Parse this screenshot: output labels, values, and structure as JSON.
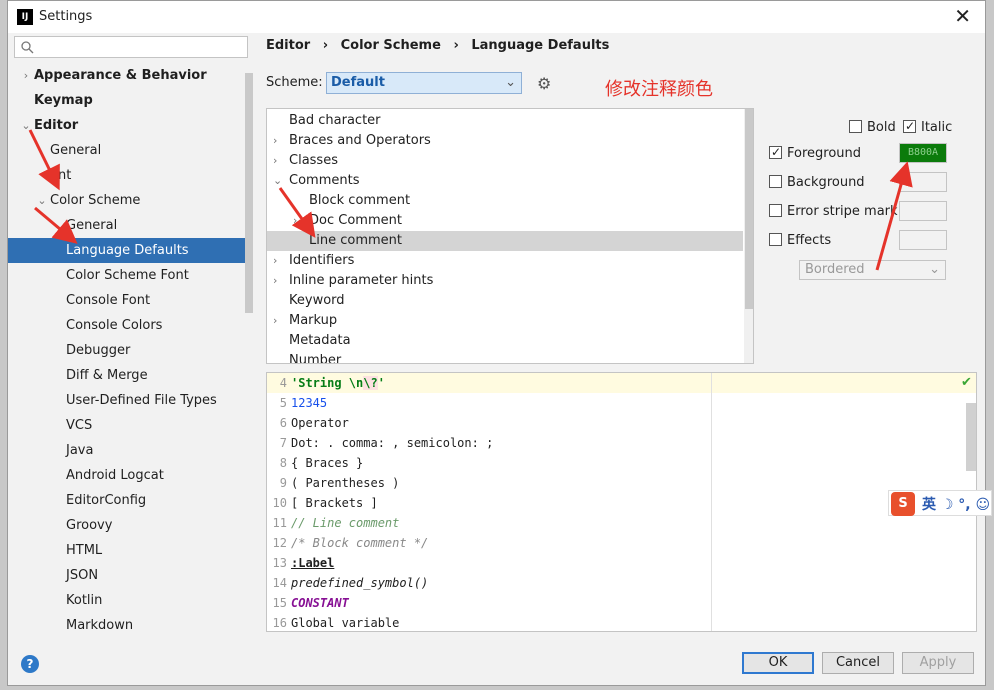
{
  "window": {
    "title": "Settings"
  },
  "search": {
    "placeholder": ""
  },
  "sidebar": {
    "items": [
      {
        "label": "Appearance & Behavior",
        "bold": true,
        "arrow": "›",
        "indent": 0
      },
      {
        "label": "Keymap",
        "bold": true,
        "arrow": "",
        "indent": 0
      },
      {
        "label": "Editor",
        "bold": true,
        "arrow": "⌄",
        "indent": 0
      },
      {
        "label": "General",
        "bold": false,
        "arrow": "",
        "indent": 1
      },
      {
        "label": "ont",
        "bold": false,
        "arrow": "",
        "indent": 1
      },
      {
        "label": "Color Scheme",
        "bold": false,
        "arrow": "⌄",
        "indent": 1
      },
      {
        "label": "General",
        "bold": false,
        "arrow": "",
        "indent": 2
      },
      {
        "label": "Language Defaults",
        "bold": false,
        "arrow": "",
        "indent": 2,
        "selected": true
      },
      {
        "label": "Color Scheme Font",
        "bold": false,
        "arrow": "",
        "indent": 2
      },
      {
        "label": "Console Font",
        "bold": false,
        "arrow": "",
        "indent": 2
      },
      {
        "label": "Console Colors",
        "bold": false,
        "arrow": "",
        "indent": 2
      },
      {
        "label": "Debugger",
        "bold": false,
        "arrow": "",
        "indent": 2
      },
      {
        "label": "Diff & Merge",
        "bold": false,
        "arrow": "",
        "indent": 2
      },
      {
        "label": "User-Defined File Types",
        "bold": false,
        "arrow": "",
        "indent": 2
      },
      {
        "label": "VCS",
        "bold": false,
        "arrow": "",
        "indent": 2
      },
      {
        "label": "Java",
        "bold": false,
        "arrow": "",
        "indent": 2
      },
      {
        "label": "Android Logcat",
        "bold": false,
        "arrow": "",
        "indent": 2
      },
      {
        "label": "EditorConfig",
        "bold": false,
        "arrow": "",
        "indent": 2
      },
      {
        "label": "Groovy",
        "bold": false,
        "arrow": "",
        "indent": 2
      },
      {
        "label": "HTML",
        "bold": false,
        "arrow": "",
        "indent": 2
      },
      {
        "label": "JSON",
        "bold": false,
        "arrow": "",
        "indent": 2
      },
      {
        "label": "Kotlin",
        "bold": false,
        "arrow": "",
        "indent": 2
      },
      {
        "label": "Markdown",
        "bold": false,
        "arrow": "",
        "indent": 2
      }
    ]
  },
  "breadcrumb": {
    "editor": "Editor",
    "color_scheme": "Color Scheme",
    "language_defaults": "Language Defaults",
    "separator": "›"
  },
  "scheme": {
    "label": "Scheme:",
    "value": "Default"
  },
  "annotation": "修改注释颜色",
  "attributes": [
    {
      "label": "Bad character",
      "arrow": "",
      "indent": 0
    },
    {
      "label": "Braces and Operators",
      "arrow": "›",
      "indent": 0
    },
    {
      "label": "Classes",
      "arrow": "›",
      "indent": 0
    },
    {
      "label": "Comments",
      "arrow": "⌄",
      "indent": 0
    },
    {
      "label": "Block comment",
      "arrow": "",
      "indent": 1
    },
    {
      "label": "Doc Comment",
      "arrow": "›",
      "indent": 1
    },
    {
      "label": "Line comment",
      "arrow": "",
      "indent": 1,
      "selected": true
    },
    {
      "label": "Identifiers",
      "arrow": "›",
      "indent": 0
    },
    {
      "label": "Inline parameter hints",
      "arrow": "›",
      "indent": 0
    },
    {
      "label": "Keyword",
      "arrow": "",
      "indent": 0
    },
    {
      "label": "Markup",
      "arrow": "›",
      "indent": 0
    },
    {
      "label": "Metadata",
      "arrow": "",
      "indent": 0
    },
    {
      "label": "Number",
      "arrow": "",
      "indent": 0
    }
  ],
  "options": {
    "bold": {
      "label": "Bold",
      "checked": false
    },
    "italic": {
      "label": "Italic",
      "checked": true
    },
    "foreground": {
      "label": "Foreground",
      "checked": true,
      "color": "B800A"
    },
    "background": {
      "label": "Background",
      "checked": false
    },
    "error_stripe": {
      "label": "Error stripe mark",
      "checked": false
    },
    "effects": {
      "label": "Effects",
      "checked": false,
      "style": "Bordered"
    }
  },
  "editor": {
    "lines": [
      {
        "n": "4",
        "parts": [
          {
            "t": "'String \\",
            "c": "c-str"
          },
          {
            "t": "n",
            "c": "c-str"
          },
          {
            "t": "\\?",
            "c": "c-str esc"
          },
          {
            "t": "'",
            "c": "c-str"
          }
        ]
      },
      {
        "n": "5",
        "parts": [
          {
            "t": "12345",
            "c": "c-num"
          }
        ]
      },
      {
        "n": "6",
        "parts": [
          {
            "t": "Operator",
            "c": ""
          }
        ]
      },
      {
        "n": "7",
        "parts": [
          {
            "t": "Dot: . comma: , semicolon: ;",
            "c": ""
          }
        ]
      },
      {
        "n": "8",
        "parts": [
          {
            "t": "{ Braces }",
            "c": ""
          }
        ]
      },
      {
        "n": "9",
        "parts": [
          {
            "t": "( Parentheses )",
            "c": ""
          }
        ]
      },
      {
        "n": "10",
        "parts": [
          {
            "t": "[ Brackets ]",
            "c": ""
          }
        ]
      },
      {
        "n": "11",
        "parts": [
          {
            "t": "// Line comment",
            "c": "c-com"
          }
        ]
      },
      {
        "n": "12",
        "parts": [
          {
            "t": "/* Block comment */",
            "c": "c-block"
          }
        ]
      },
      {
        "n": "13",
        "parts": [
          {
            "t": ":Label",
            "c": "c-label"
          }
        ]
      },
      {
        "n": "14",
        "parts": [
          {
            "t": "predefined_symbol()",
            "c": "c-sym"
          }
        ]
      },
      {
        "n": "15",
        "parts": [
          {
            "t": "CONSTANT",
            "c": "c-const"
          }
        ]
      },
      {
        "n": "16",
        "parts": [
          {
            "t": "Global variable",
            "c": ""
          }
        ]
      }
    ]
  },
  "buttons": {
    "ok": "OK",
    "cancel": "Cancel",
    "apply": "Apply"
  },
  "ime": {
    "badge": "S",
    "text": "英 ☽ °, ☺"
  },
  "colors": {
    "accent": "#2f6fb3",
    "foreground_swatch": "#0b7b0b",
    "annotation": "#e5332a"
  }
}
